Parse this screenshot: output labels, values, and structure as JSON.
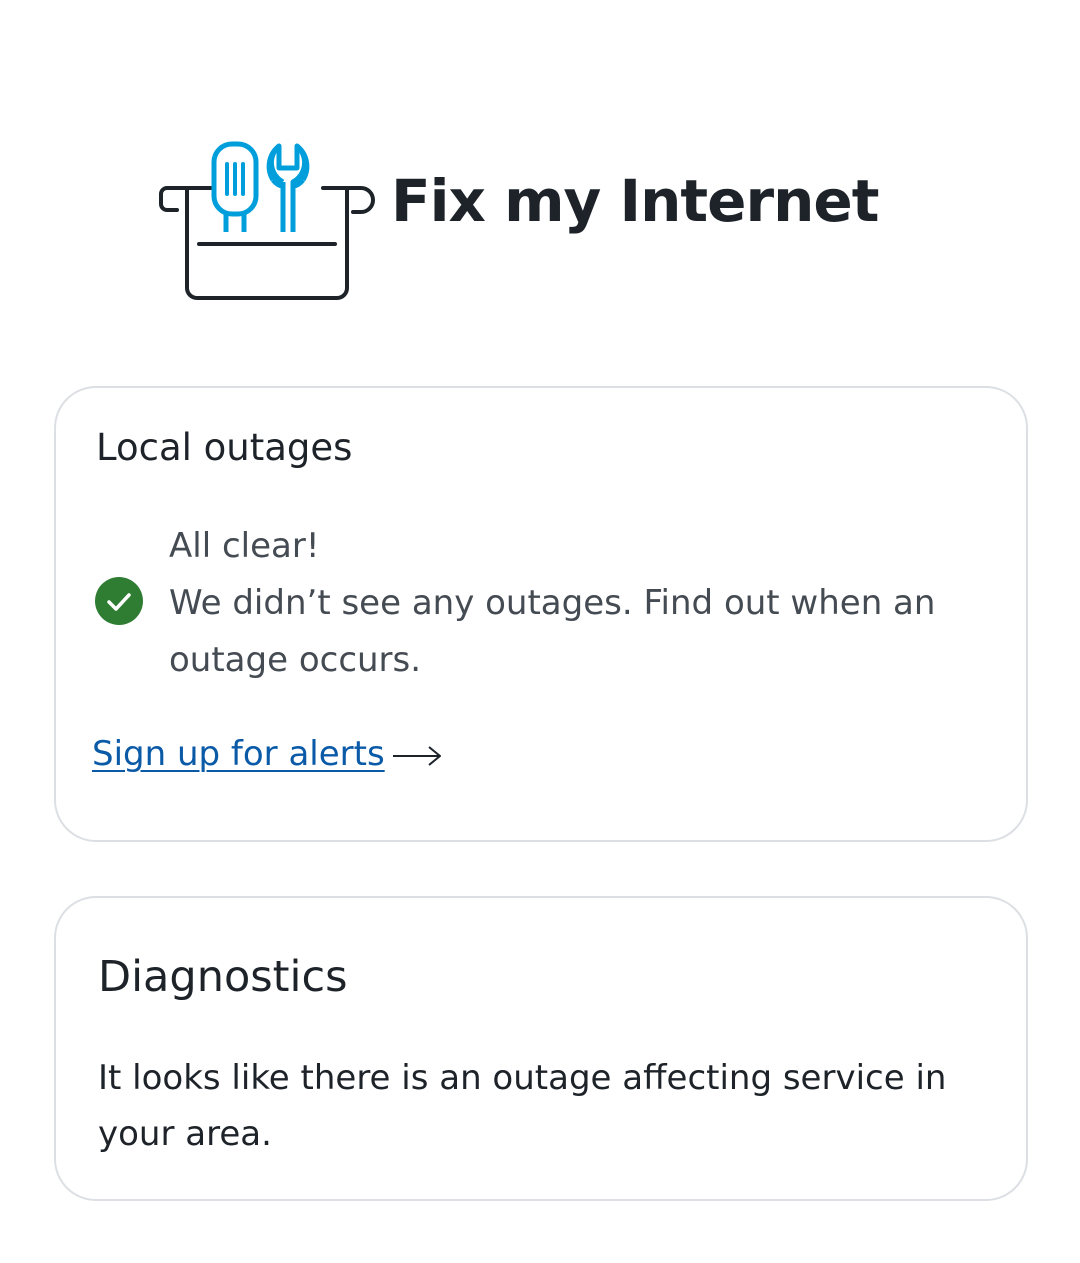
{
  "header": {
    "title": "Fix my Internet",
    "illustration_icon": "toolbox-icon"
  },
  "outages_card": {
    "heading": "Local outages",
    "status_icon": "check-circle-icon",
    "status_title": "All clear!",
    "status_body": "We didn’t see any outages. Find out when an outage occurs.",
    "link_label": "Sign up for alerts",
    "link_icon": "arrow-right-icon"
  },
  "diagnostics_card": {
    "heading": "Diagnostics",
    "body": "It looks like there is an outage affecting service in your area."
  },
  "colors": {
    "accent_blue": "#009fdb",
    "link_blue": "#0a5aa8",
    "success_green": "#2e7d32",
    "text_dark": "#1d2329",
    "card_border": "#dcdfe3"
  }
}
